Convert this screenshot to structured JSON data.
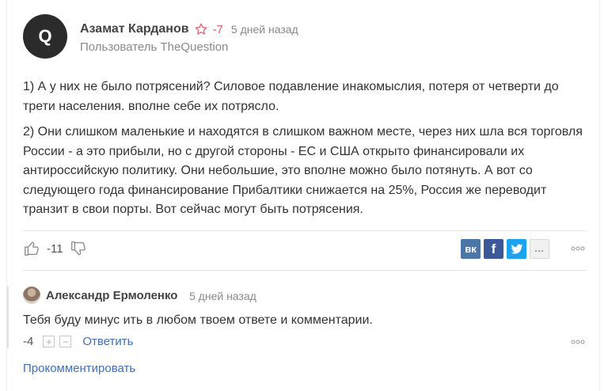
{
  "answer": {
    "avatar_letter": "Q",
    "author_name": "Азамат Карданов",
    "rating": "-7",
    "time": "5 дней назад",
    "author_subtitle": "Пользователь TheQuestion",
    "paragraphs": [
      "1) А у них не было потрясений? Силовое подавление инакомыслия, потеря от четверти до трети населения. вполне себе их потрясло.",
      "2) Они слишком маленькие и находятся в слишком важном месте, через них шла вся торговля России - а это прибыли, но с другой стороны - ЕС и США открыто финансировали их антироссийскую политику. Они небольшие, это вполне можно было потянуть. А вот со следующего года финансирование Прибалтики снижается на 25%, Россия же переводит транзит в свои порты. Вот сейчас могут быть потрясения."
    ],
    "votes": "-11",
    "share": {
      "vk": "вк",
      "fb": "f",
      "tw": "t",
      "more": "..."
    }
  },
  "comment": {
    "author_name": "Александр Ермоленко",
    "time": "5 дней назад",
    "text": "Тебя буду минус ить в любом твоем ответе и комментарии.",
    "score": "-4",
    "plus": "+",
    "minus": "−",
    "reply_label": "Ответить"
  },
  "comment_link": "Прокомментировать",
  "colors": {
    "accent_link": "#3f6fb5",
    "rating_red": "#e05a6a",
    "vk": "#4a76a8",
    "facebook": "#3b5998",
    "twitter": "#1da1f2"
  },
  "icons": [
    "star-icon",
    "thumbs-up-icon",
    "thumbs-down-icon",
    "vk-icon",
    "facebook-icon",
    "twitter-icon",
    "more-icon",
    "dots-menu-icon"
  ]
}
